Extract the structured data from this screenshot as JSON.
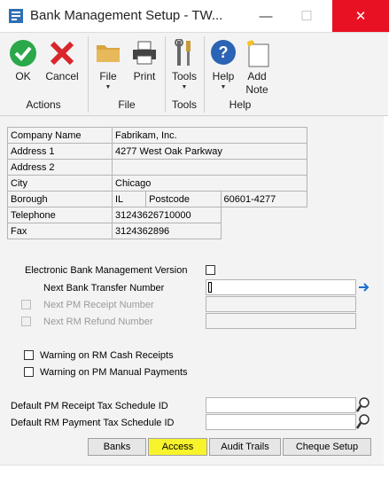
{
  "window": {
    "title": "Bank Management Setup  -  TW...",
    "minimize": "—",
    "maximize": "☐",
    "close": "✕"
  },
  "ribbon": {
    "actions": {
      "ok": "OK",
      "cancel": "Cancel",
      "group": "Actions"
    },
    "file": {
      "file": "File",
      "print": "Print",
      "group": "File"
    },
    "tools": {
      "tools": "Tools",
      "group": "Tools"
    },
    "help": {
      "help": "Help",
      "add_note_1": "Add",
      "add_note_2": "Note",
      "group": "Help"
    }
  },
  "company": {
    "name_label": "Company Name",
    "name": "Fabrikam, Inc.",
    "address1_label": "Address 1",
    "address1": "4277 West Oak Parkway",
    "address2_label": "Address 2",
    "address2": "",
    "city_label": "City",
    "city": "Chicago",
    "borough_label": "Borough",
    "borough": "IL",
    "postcode_label": "Postcode",
    "postcode": "60601-4277",
    "telephone_label": "Telephone",
    "telephone": "31243626710000",
    "fax_label": "Fax",
    "fax": "3124362896"
  },
  "form": {
    "ebm_version_label": "Electronic Bank Management  Version",
    "next_bank_transfer_label": "Next Bank Transfer Number",
    "next_bank_transfer_value": "",
    "next_pm_receipt_label": "Next PM Receipt Number",
    "next_rm_refund_label": "Next RM Refund Number",
    "warn_rm_cash_label": "Warning on RM Cash Receipts",
    "warn_pm_manual_label": "Warning on PM Manual Payments",
    "default_pm_tax_label": "Default PM Receipt Tax Schedule ID",
    "default_rm_tax_label": "Default RM Payment Tax Schedule ID",
    "default_pm_tax_value": "",
    "default_rm_tax_value": ""
  },
  "buttons": {
    "banks": "Banks",
    "access": "Access",
    "audit_trails": "Audit Trails",
    "cheque_setup": "Cheque Setup"
  },
  "colors": {
    "close": "#e81123",
    "highlight": "#f8f42b",
    "ok_green": "#2aa84a",
    "cancel_red": "#d8262c",
    "help_blue": "#2b63b5",
    "arrow_blue": "#1a6fd1"
  }
}
